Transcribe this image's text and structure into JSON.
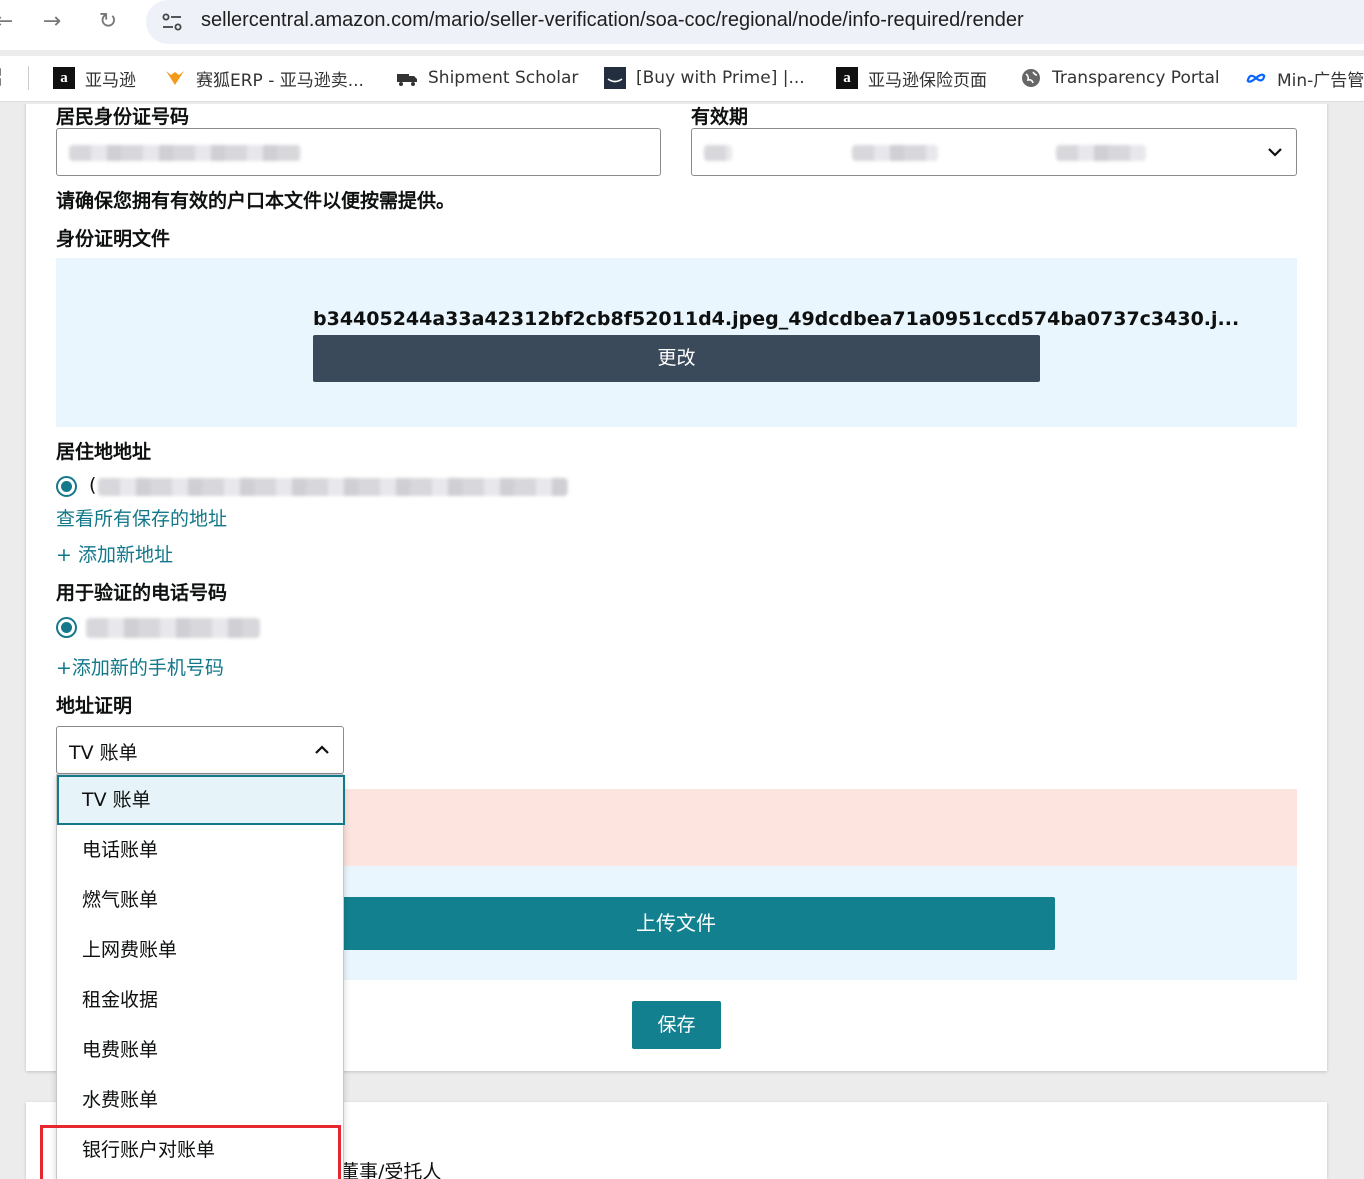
{
  "browser": {
    "url": "sellercentral.amazon.com/mario/seller-verification/soa-coc/regional/node/info-required/render",
    "bookmarks": [
      {
        "label": "亚马逊",
        "icon": "amazon-icon"
      },
      {
        "label": "赛狐ERP - 亚马逊卖...",
        "icon": "saihu-fox-icon"
      },
      {
        "label": "Shipment Scholar",
        "icon": "truck-icon"
      },
      {
        "label": "[Buy with Prime] |...",
        "icon": "amazon-smile-icon"
      },
      {
        "label": "亚马逊保险页面",
        "icon": "amazon-icon"
      },
      {
        "label": "Transparency Portal",
        "icon": "globe-icon"
      },
      {
        "label": "Min-广告管",
        "icon": "meta-icon"
      }
    ]
  },
  "form": {
    "id_number_label": "居民身份证号码",
    "expiry_label": "有效期",
    "hukou_notice": "请确保您拥有有效的户口本文件以便按需提供。",
    "id_document_label": "身份证明文件",
    "uploaded_filename": "b34405244a33a42312bf2cb8f52011d4.jpeg_49dcdbea71a0951ccd574ba0737c3430.j...",
    "change_button": "更改",
    "residential_address_label": "居住地地址",
    "address_prefix": "(",
    "view_saved_addresses_link": "查看所有保存的地址",
    "add_address_link": "+ 添加新地址",
    "phone_label": "用于验证的电话号码",
    "add_phone_link": "+添加新的手机号码",
    "proof_of_address_label": "地址证明",
    "proof_selected": "TV 账单",
    "proof_options": [
      "TV 账单",
      "电话账单",
      "燃气账单",
      "上网费账单",
      "租金收据",
      "电费账单",
      "水费账单",
      "银行账户对账单"
    ],
    "upload_button": "上传文件",
    "save_button": "保存"
  },
  "next_section": {
    "partial_text": "董事/受托人"
  },
  "colors": {
    "teal": "#12808f",
    "link": "#12788a",
    "dark_button": "#3b4a5a",
    "highlight_red": "#e8262f"
  }
}
